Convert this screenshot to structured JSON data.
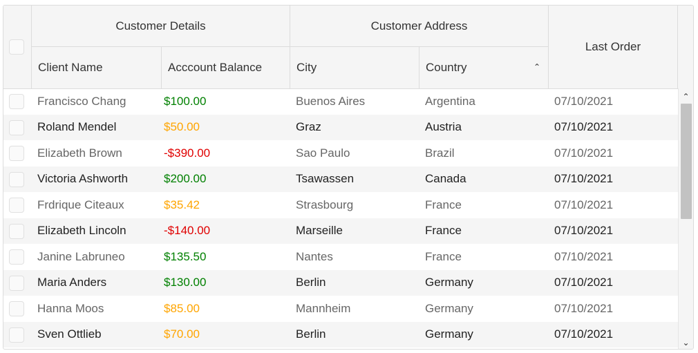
{
  "header": {
    "group_customer_details": "Customer Details",
    "group_customer_address": "Customer Address",
    "col_client_name": "Client Name",
    "col_account_balance": "Acccount Balance",
    "col_city": "City",
    "col_country": "Country",
    "col_last_order": "Last Order",
    "sort_icon": "chevron-up-icon"
  },
  "colors": {
    "positive": "#008000",
    "warning": "#ffa500",
    "negative": "#e00000"
  },
  "rows": [
    {
      "name": "Francisco Chang",
      "balance": "$100.00",
      "status": "positive",
      "city": "Buenos Aires",
      "country": "Argentina",
      "last_order": "07/10/2021"
    },
    {
      "name": "Roland Mendel",
      "balance": "$50.00",
      "status": "warning",
      "city": "Graz",
      "country": "Austria",
      "last_order": "07/10/2021"
    },
    {
      "name": "Elizabeth Brown",
      "balance": "-$390.00",
      "status": "negative",
      "city": "Sao Paulo",
      "country": "Brazil",
      "last_order": "07/10/2021"
    },
    {
      "name": "Victoria Ashworth",
      "balance": "$200.00",
      "status": "positive",
      "city": "Tsawassen",
      "country": "Canada",
      "last_order": "07/10/2021"
    },
    {
      "name": "Frdrique Citeaux",
      "balance": "$35.42",
      "status": "warning",
      "city": "Strasbourg",
      "country": "France",
      "last_order": "07/10/2021"
    },
    {
      "name": "Elizabeth Lincoln",
      "balance": "-$140.00",
      "status": "negative",
      "city": "Marseille",
      "country": "France",
      "last_order": "07/10/2021"
    },
    {
      "name": "Janine Labruneo",
      "balance": "$135.50",
      "status": "positive",
      "city": "Nantes",
      "country": "France",
      "last_order": "07/10/2021"
    },
    {
      "name": "Maria Anders",
      "balance": "$130.00",
      "status": "positive",
      "city": "Berlin",
      "country": "Germany",
      "last_order": "07/10/2021"
    },
    {
      "name": "Hanna Moos",
      "balance": "$85.00",
      "status": "warning",
      "city": "Mannheim",
      "country": "Germany",
      "last_order": "07/10/2021"
    },
    {
      "name": "Sven Ottlieb",
      "balance": "$70.00",
      "status": "warning",
      "city": "Berlin",
      "country": "Germany",
      "last_order": "07/10/2021"
    }
  ],
  "scrollbar": {
    "up_icon": "chevron-up-icon",
    "down_icon": "chevron-down-icon"
  }
}
